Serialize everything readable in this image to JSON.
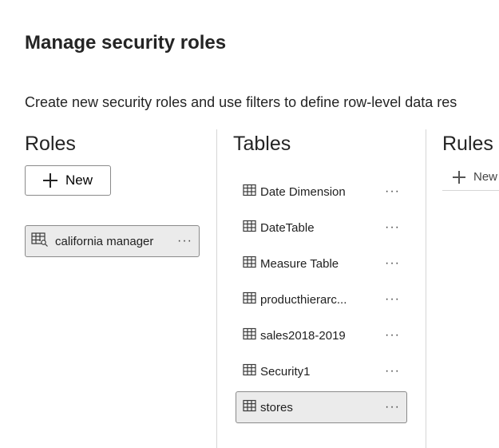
{
  "page": {
    "title": "Manage security roles",
    "description": "Create new security roles and use filters to define row-level data res"
  },
  "roles": {
    "heading": "Roles",
    "new_label": "New",
    "items": [
      {
        "label": "california manager",
        "menu": "···"
      }
    ]
  },
  "tables": {
    "heading": "Tables",
    "menu": "···",
    "selected": "stores",
    "items": [
      {
        "label": "Date Dimension"
      },
      {
        "label": "DateTable"
      },
      {
        "label": "Measure Table"
      },
      {
        "label": "producthierarc..."
      },
      {
        "label": "sales2018-2019"
      },
      {
        "label": "Security1"
      },
      {
        "label": "stores"
      }
    ]
  },
  "rules": {
    "heading": "Rules",
    "new_label": "New"
  },
  "icons": {
    "role_item": "table-with-key-icon",
    "table_item": "table-grid-icon",
    "add": "plus-icon",
    "more": "more-options-icon"
  }
}
